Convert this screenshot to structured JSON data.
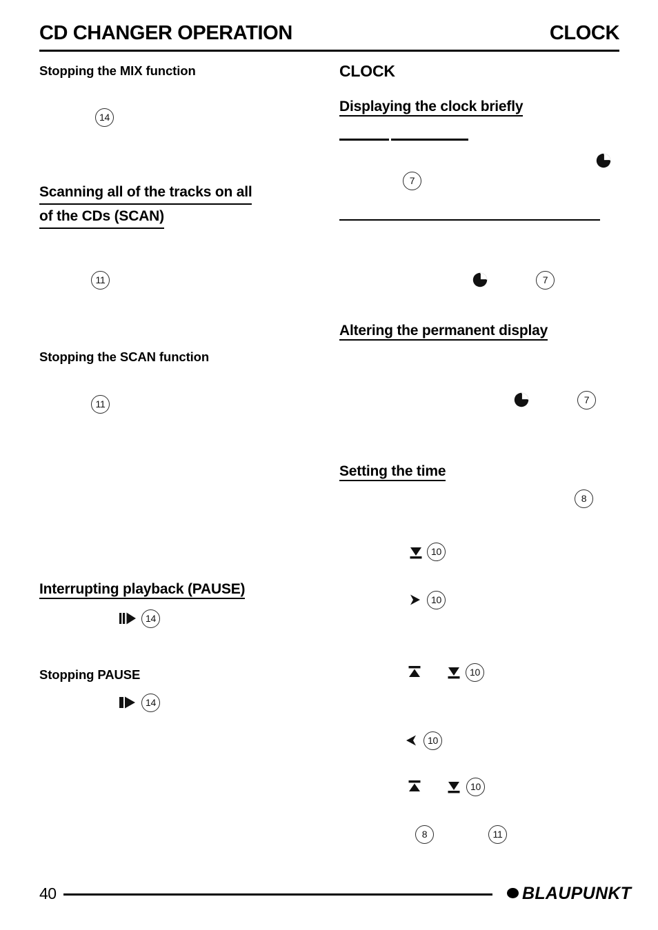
{
  "header": {
    "left_title": "CD CHANGER OPERATION",
    "right_title": "CLOCK"
  },
  "left_column": {
    "heading_mix_stop": "Stopping the MIX function",
    "badge_mix_stop": "14",
    "heading_scan_line1": "Scanning all of the tracks on all",
    "heading_scan_line2": "of the CDs (SCAN)",
    "badge_scan": "11",
    "heading_scan_stop": "Stopping the SCAN function",
    "badge_scan_stop": "11",
    "heading_pause": "Interrupting playback (PAUSE)",
    "badge_pause": "14",
    "pause_icon": "pause-play-icon",
    "heading_pause_stop": "Stopping PAUSE",
    "badge_pause_stop": "14",
    "pause_stop_icon": "play-icon"
  },
  "right_column": {
    "section_title": "CLOCK",
    "heading_display_brief": "Displaying the clock briefly",
    "badge_display_brief": "7",
    "clock_icon_1": "clock-icon",
    "badge_display_brief_2": "7",
    "clock_icon_2": "clock-icon",
    "heading_alter_permanent": "Altering the permanent display",
    "badge_alter": "7",
    "clock_icon_3": "clock-icon",
    "heading_setting_time": "Setting the time",
    "badge_set_enter": "8",
    "badge_down_1": "10",
    "glyph_down_1": "down-arrow-icon",
    "badge_right": "10",
    "glyph_right": "right-arrow-icon",
    "badge_updown_1": "10",
    "glyph_up_1": "up-arrow-icon",
    "glyph_down_2": "down-arrow-icon",
    "badge_left": "10",
    "glyph_left": "left-arrow-icon",
    "badge_updown_2": "10",
    "glyph_up_2": "up-arrow-icon",
    "glyph_down_3": "down-arrow-icon",
    "badge_confirm_8": "8",
    "badge_confirm_11": "11"
  },
  "footer": {
    "page_number": "40",
    "brand": "BLAUPUNKT"
  }
}
